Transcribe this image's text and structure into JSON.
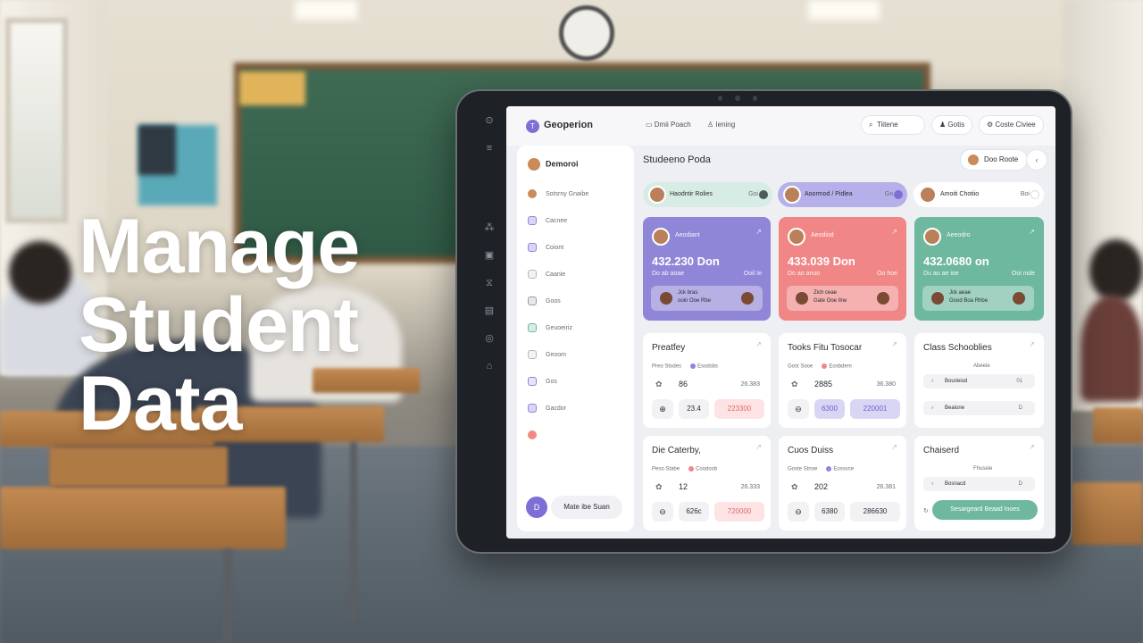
{
  "headline": {
    "line1": "Manage",
    "line2": "Student",
    "line3": "Data"
  },
  "app": {
    "logo_letter": "T",
    "brand": "Geoperion",
    "crumb1": "Dmii Poach",
    "crumb2": "Iening",
    "search_label": "Tiitene",
    "pill2": "Gotis",
    "pill3": "Coste Civiee"
  },
  "sidebar": {
    "header": "Demoroi",
    "items": [
      {
        "label": "Sotsrny Gnaibe",
        "icon": "user-icon",
        "color": "#c98b5a"
      },
      {
        "label": "Cacnee",
        "icon": "calendar-icon",
        "color": "#8e86d8"
      },
      {
        "label": "Coiont",
        "icon": "group-icon",
        "color": "#8e86d8"
      },
      {
        "label": "Caanie",
        "icon": "document-icon",
        "color": "#b6b8c0"
      },
      {
        "label": "Goos",
        "icon": "chart-icon",
        "color": "#9a9ca4"
      },
      {
        "label": "Geuoeiriz",
        "icon": "book-icon",
        "color": "#6fb8a0"
      },
      {
        "label": "Geoom",
        "icon": "settings-icon",
        "color": "#b6b8c0"
      },
      {
        "label": "Gos",
        "icon": "folder-icon",
        "color": "#8e86d8"
      },
      {
        "label": "Gacdor",
        "icon": "archive-icon",
        "color": "#8e86d8"
      },
      {
        "label": "",
        "icon": "alert-icon",
        "color": "#f08a80"
      }
    ],
    "footer_initial": "D",
    "footer_name": "Mate ibe Suan"
  },
  "main": {
    "title": "Studeeno Poda",
    "doc_button": "Doo Roote",
    "more_button": "‹",
    "chips": [
      {
        "name": "Haodntir Rolies",
        "value": "Goi",
        "bg": "#d7ece4",
        "dot": "#4c5a5a"
      },
      {
        "name": "Aoormod / Pidlea",
        "value": "Go",
        "bg": "#b6b0ea",
        "dot": "#7d6fd6"
      },
      {
        "name": "Amoiti Chotiio",
        "value": "Boi",
        "bg": "#ffffff",
        "dot": "#ffffff"
      }
    ],
    "stats": [
      {
        "label": "Aeodiant",
        "big": "432.230 Don",
        "sub": "Do ab aoae",
        "sub2": "Ooil Ie",
        "row_text1": "Jck bras",
        "row_text2": "ooin  Ooe Rbe",
        "color": "#8f86d8"
      },
      {
        "label": "Aeodiod",
        "big": "433.039 Don",
        "sub": "Do ao anuo",
        "sub2": "Oo hoe",
        "row_text1": "Zich ceae",
        "row_text2": "Gate  Ooe Ilne",
        "color": "#f08686"
      },
      {
        "label": "Aeeodro",
        "big": "432.0680 on",
        "sub": "Du au ae ioe",
        "sub2": "Ooi nide",
        "row_text1": "Jck aeae",
        "row_text2": "Good  Boa Rhbe",
        "color": "#6fb8a0"
      }
    ],
    "cards": [
      {
        "title": "Preatfey",
        "legend_a": "Preo",
        "legend_b": "Stodes",
        "legend_c": "Esodsbs",
        "dot": "#8e86d8",
        "icon1": "✿",
        "n1": "86",
        "v1": "26.383",
        "c2": "⊕",
        "n2": "23.4",
        "p2": "223300",
        "p2_bg": "#fde3e3",
        "p2_fg": "#e06a6a"
      },
      {
        "title": "Tooks Fitu Tosocar",
        "legend_a": "Gost",
        "legend_b": "Sooe",
        "legend_c": "Eosbdem",
        "dot": "#f08686",
        "icon1": "✿",
        "n1": "2885",
        "v1": "36.380",
        "c2": "⊖",
        "n2": "6300",
        "p2": "220001",
        "p2_bg": "#d9d6f5",
        "p2_fg": "#6a5fcf"
      },
      {
        "title": "Die Caterby,",
        "legend_a": "Peso",
        "legend_b": "Stabe",
        "legend_c": "Coodosb",
        "dot": "#f08686",
        "icon1": "✿",
        "n1": "12",
        "v1": "26.333",
        "c2": "⊖",
        "n2": "626c",
        "p2": "720000",
        "p2_bg": "#fde3e3",
        "p2_fg": "#e06a6a"
      },
      {
        "title": "Cuos Duiss",
        "legend_a": "Goste",
        "legend_b": "Stnoe",
        "legend_c": "Eossvce",
        "dot": "#8e86d8",
        "icon1": "✿",
        "n1": "202",
        "v1": "26.381",
        "c2": "⊖",
        "n2": "6380",
        "p2": "286630",
        "p2_bg": "#f2f2f5",
        "p2_fg": "#2b2d33"
      }
    ],
    "lists": [
      {
        "title": "Class Schooblies",
        "sub": "Abeeie",
        "rows": [
          {
            "icon": "♁",
            "label": "Bourieiod",
            "right": "01"
          },
          {
            "icon": "♁",
            "label": "Beaione",
            "right": "D"
          }
        ]
      },
      {
        "title": "Chaiserd",
        "sub": "Fhuseie",
        "rows": [
          {
            "icon": "♁",
            "label": "Bosnacd",
            "right": "D"
          }
        ],
        "button": "Sesargeard Beaad Inoes",
        "button_icon": "↻"
      }
    ]
  }
}
